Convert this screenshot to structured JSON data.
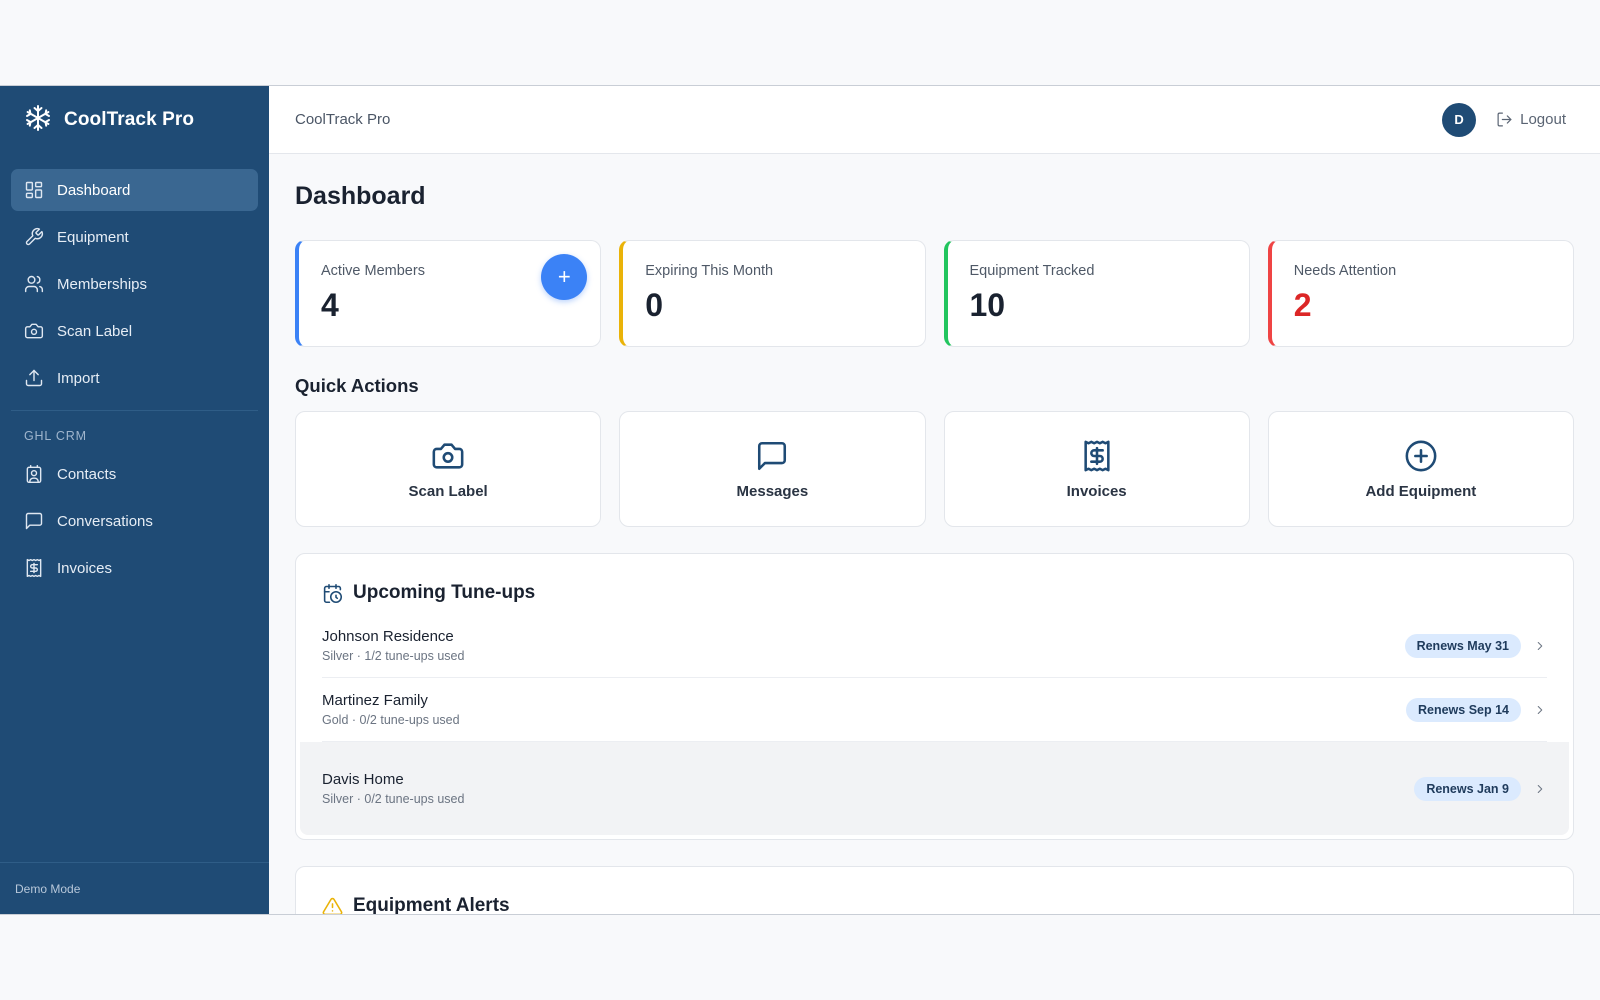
{
  "app": {
    "brand": "CoolTrack Pro",
    "footer": "Demo Mode"
  },
  "sidebar": {
    "items": [
      {
        "label": "Dashboard",
        "icon": "dashboard-grid-icon",
        "active": true
      },
      {
        "label": "Equipment",
        "icon": "wrench-icon"
      },
      {
        "label": "Memberships",
        "icon": "users-icon"
      },
      {
        "label": "Scan Label",
        "icon": "camera-icon"
      },
      {
        "label": "Import",
        "icon": "upload-icon"
      }
    ],
    "section_label": "GHL CRM",
    "crm_items": [
      {
        "label": "Contacts",
        "icon": "contact-card-icon"
      },
      {
        "label": "Conversations",
        "icon": "message-icon"
      },
      {
        "label": "Invoices",
        "icon": "invoice-icon"
      }
    ]
  },
  "topbar": {
    "title": "CoolTrack Pro",
    "avatar_initial": "D",
    "logout_label": "Logout"
  },
  "page": {
    "title": "Dashboard"
  },
  "stats": [
    {
      "label": "Active Members",
      "value": "4",
      "accent": "#3b82f6",
      "add_button": "+"
    },
    {
      "label": "Expiring This Month",
      "value": "0",
      "accent": "#eab308"
    },
    {
      "label": "Equipment Tracked",
      "value": "10",
      "accent": "#22c55e"
    },
    {
      "label": "Needs Attention",
      "value": "2",
      "accent": "#ef4444",
      "value_color": "#dc2626"
    }
  ],
  "quick_actions": {
    "title": "Quick Actions",
    "items": [
      {
        "label": "Scan Label",
        "icon": "camera-icon"
      },
      {
        "label": "Messages",
        "icon": "message-icon"
      },
      {
        "label": "Invoices",
        "icon": "invoice-icon"
      },
      {
        "label": "Add Equipment",
        "icon": "plus-circle-icon"
      }
    ]
  },
  "tuneups": {
    "title": "Upcoming Tune-ups",
    "rows": [
      {
        "name": "Johnson Residence",
        "sub": "Silver · 1/2 tune-ups used",
        "badge": "Renews May 31"
      },
      {
        "name": "Martinez Family",
        "sub": "Gold · 0/2 tune-ups used",
        "badge": "Renews Sep 14"
      },
      {
        "name": "Davis Home",
        "sub": "Silver · 0/2 tune-ups used",
        "badge": "Renews Jan 9"
      }
    ]
  },
  "alerts": {
    "title": "Equipment Alerts",
    "icon_color": "#eab308"
  }
}
